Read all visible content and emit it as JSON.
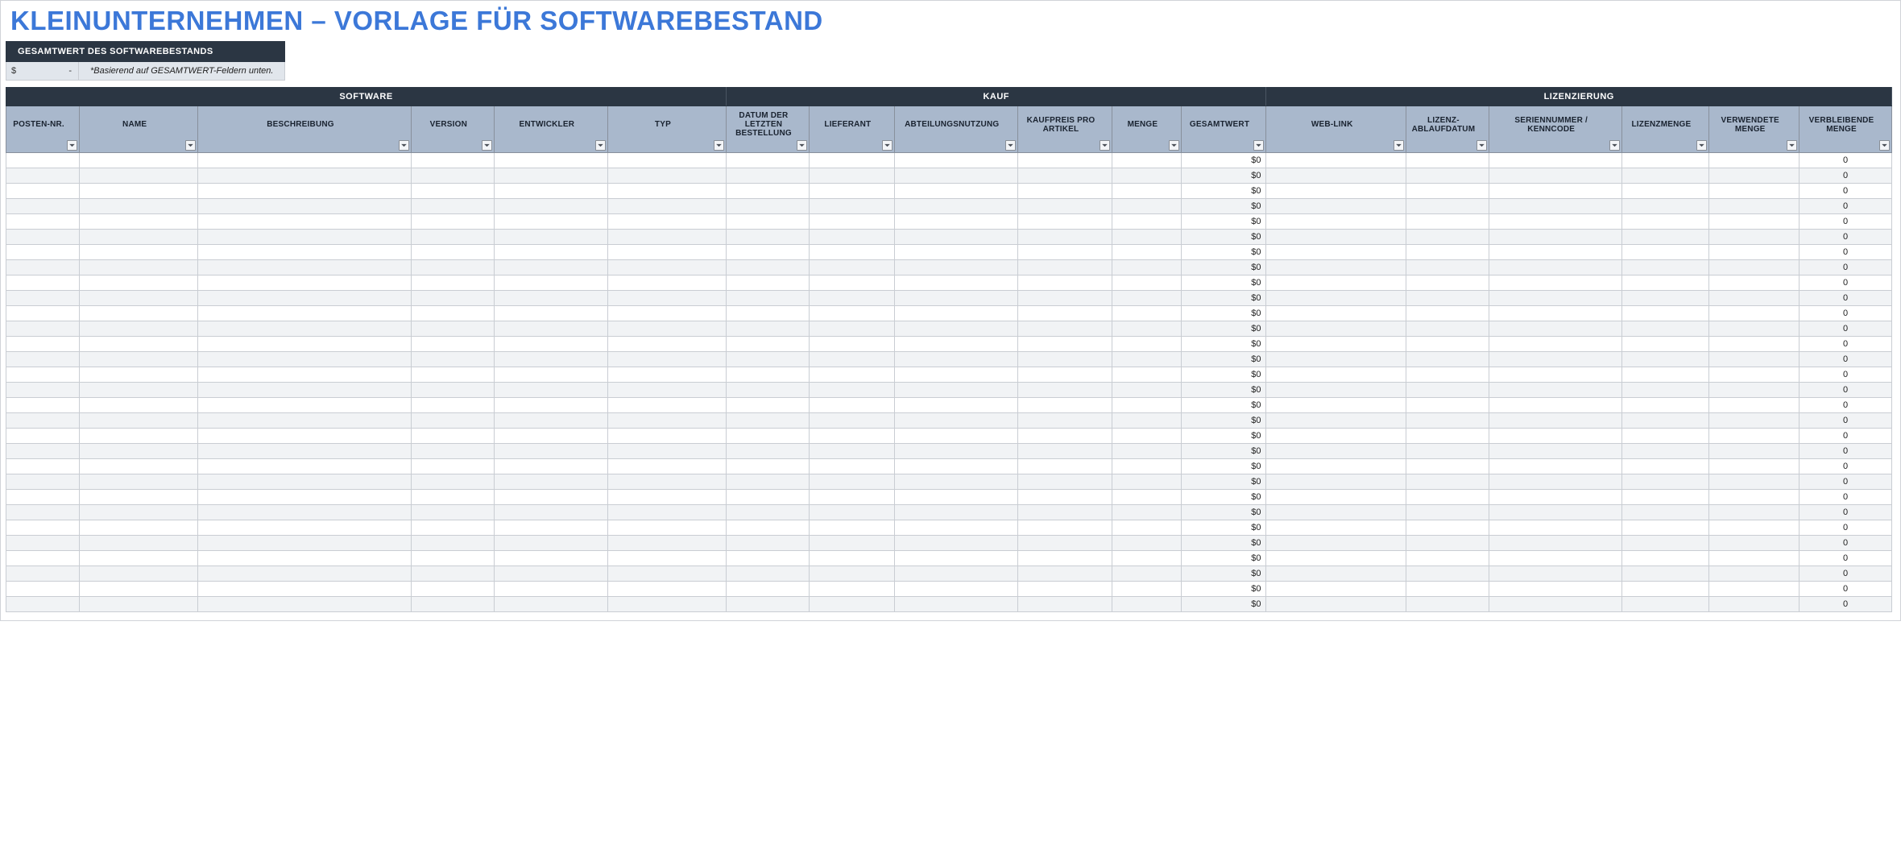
{
  "title": "KLEINUNTERNEHMEN – VORLAGE FÜR SOFTWAREBESTAND",
  "summary": {
    "header": "GESAMTWERT DES SOFTWAREBESTANDS",
    "currency_symbol": "$",
    "value": "-",
    "note": "*Basierend auf GESAMTWERT-Feldern unten."
  },
  "groups": {
    "software": "SOFTWARE",
    "kauf": "KAUF",
    "lizenzierung": "LIZENZIERUNG"
  },
  "columns": {
    "posten": "POSTEN-NR.",
    "name": "NAME",
    "beschreibung": "BESCHREIBUNG",
    "version": "VERSION",
    "entwickler": "ENTWICKLER",
    "typ": "TYP",
    "datum": "DATUM DER LETZTEN BESTELLUNG",
    "lieferant": "LIEFERANT",
    "abteilung": "ABTEILUNGSNUTZUNG",
    "preis": "KAUFPREIS PRO ARTIKEL",
    "menge": "MENGE",
    "gesamtwert": "GESAMTWERT",
    "weblink": "WEB-LINK",
    "lizenz_ablauf": "LIZENZ-ABLAUFDATUM",
    "seriennummer": "SERIENNUMMER / KENNCODE",
    "lizenzmenge": "LIZENZMENGE",
    "verwendete_menge": "VERWENDETE MENGE",
    "verbleibende_menge": "VERBLEIBENDE MENGE"
  },
  "row_count": 30,
  "row_defaults": {
    "gesamtwert": "$0",
    "verbleibende_menge": "0"
  }
}
